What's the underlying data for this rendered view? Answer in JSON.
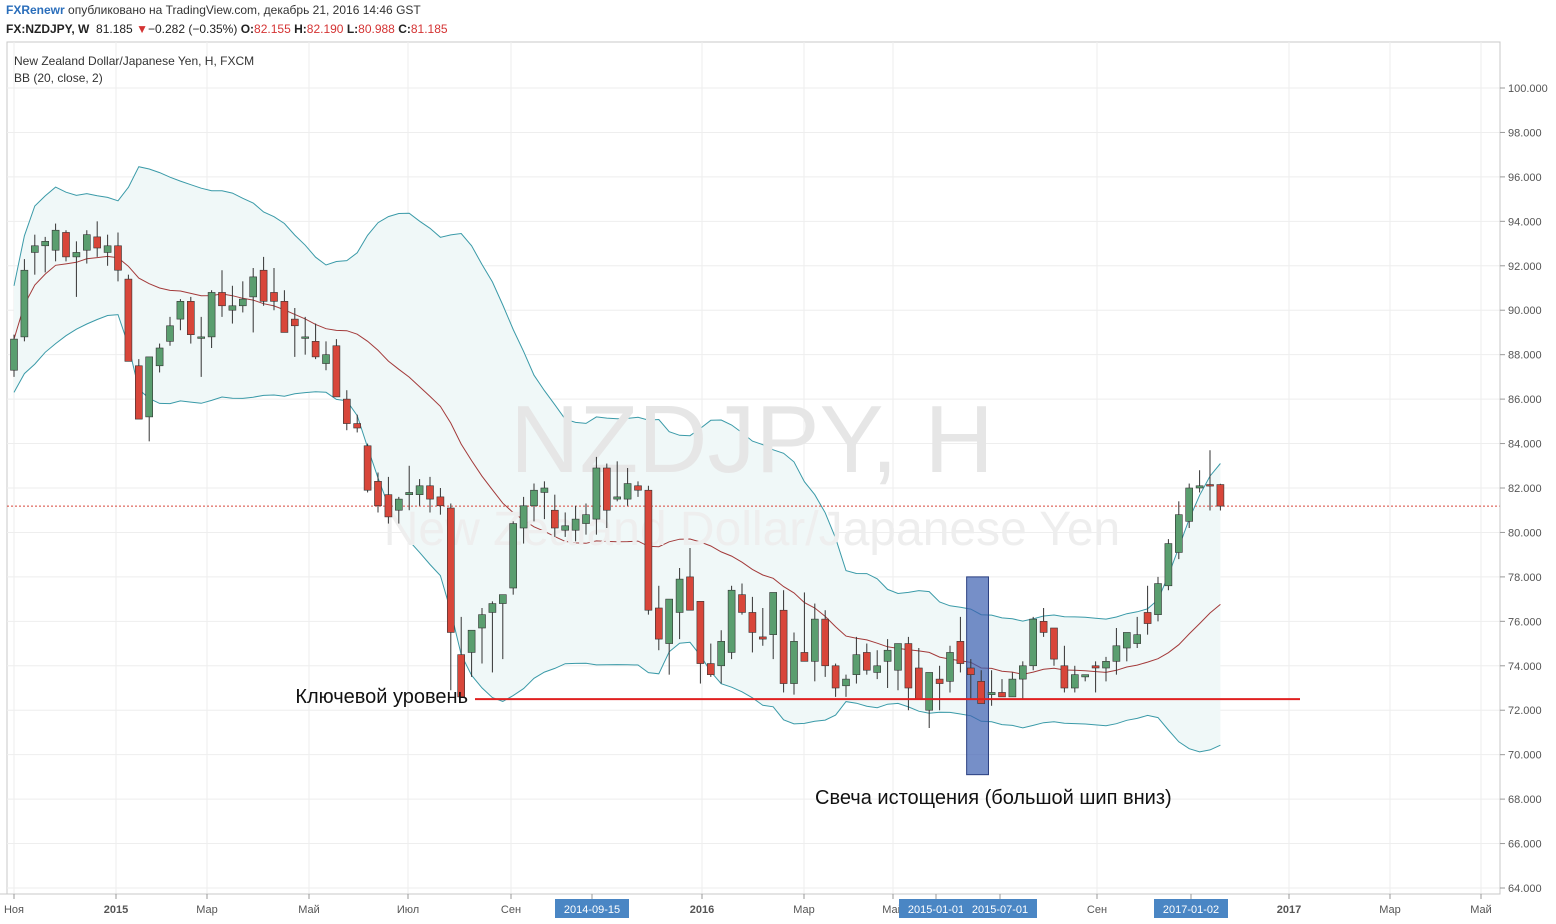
{
  "header": {
    "brand": "FXRenewr",
    "published": "опубликовано на TradingView.com, декабрь 21, 2016 14:46 GST",
    "symbol": "FX:NZDJPY, W",
    "last": "81.185",
    "down_arrow": "▼",
    "change": "−0.282 (−0.35%)",
    "o_label": "O:",
    "o_value": "82.155",
    "h_label": "H:",
    "h_value": "82.190",
    "l_label": "L:",
    "l_value": "80.988",
    "c_label": "C:",
    "c_value": "81.185"
  },
  "legend": {
    "title": "New Zealand Dollar/Japanese Yen, H, FXCM",
    "indicator": "BB (20, close, 2)"
  },
  "watermark": {
    "symbol": "NZDJPY, H",
    "name": "New Zealand Dollar/Japanese Yen"
  },
  "annotations": {
    "key_level_label": "Ключевой уровень",
    "exhaustion_label": "Свеча истощения (большой шип вниз)"
  },
  "colors": {
    "up": "#5a9e6f",
    "down": "#d8463a",
    "band": "#3a9aa8",
    "basis": "#a33a3a",
    "band_fill": "#f0f8f8",
    "key_line": "#e02020",
    "highlight": "#3c5fb0",
    "date_tag": "#4a86c4"
  },
  "chart_data": {
    "type": "candlestick",
    "y_axis": {
      "min": 64,
      "max": 100,
      "ticks": [
        "100.000",
        "98.000",
        "96.000",
        "94.000",
        "92.000",
        "90.000",
        "88.000",
        "86.000",
        "84.000",
        "82.000",
        "80.000",
        "78.000",
        "76.000",
        "74.000",
        "72.000",
        "70.000",
        "68.000",
        "66.000",
        "64.000"
      ]
    },
    "x_axis": {
      "labels": [
        "Ноя",
        "2015",
        "Мар",
        "Май",
        "Июл",
        "Сен",
        "2014-09-15",
        "2016",
        "Мар",
        "Май",
        "2015-01-01",
        "2015-07-01",
        "Сен",
        "2017-01-02",
        "2017",
        "Мар",
        "Май"
      ]
    },
    "last_price": 81.185,
    "key_level": 72.5,
    "candles": [
      {
        "o": 87.3,
        "h": 88.9,
        "l": 87.0,
        "c": 88.7
      },
      {
        "o": 88.8,
        "h": 92.3,
        "l": 88.6,
        "c": 91.8
      },
      {
        "o": 92.6,
        "h": 93.4,
        "l": 91.6,
        "c": 92.9
      },
      {
        "o": 92.9,
        "h": 93.3,
        "l": 91.7,
        "c": 93.1
      },
      {
        "o": 92.7,
        "h": 93.9,
        "l": 92.2,
        "c": 93.6
      },
      {
        "o": 93.5,
        "h": 93.6,
        "l": 92.2,
        "c": 92.4
      },
      {
        "o": 92.4,
        "h": 93.1,
        "l": 90.6,
        "c": 92.6
      },
      {
        "o": 92.7,
        "h": 93.6,
        "l": 92.1,
        "c": 93.4
      },
      {
        "o": 93.3,
        "h": 94.0,
        "l": 92.4,
        "c": 92.8
      },
      {
        "o": 92.6,
        "h": 93.4,
        "l": 92.0,
        "c": 92.9
      },
      {
        "o": 92.9,
        "h": 93.5,
        "l": 91.3,
        "c": 91.8
      },
      {
        "o": 91.4,
        "h": 91.6,
        "l": 87.8,
        "c": 87.7
      },
      {
        "o": 87.5,
        "h": 87.8,
        "l": 85.2,
        "c": 85.1
      },
      {
        "o": 85.2,
        "h": 87.7,
        "l": 84.1,
        "c": 87.9
      },
      {
        "o": 87.5,
        "h": 88.5,
        "l": 87.2,
        "c": 88.3
      },
      {
        "o": 88.6,
        "h": 89.7,
        "l": 88.4,
        "c": 89.3
      },
      {
        "o": 89.6,
        "h": 90.5,
        "l": 89.1,
        "c": 90.4
      },
      {
        "o": 90.4,
        "h": 90.6,
        "l": 88.5,
        "c": 88.9
      },
      {
        "o": 88.8,
        "h": 89.7,
        "l": 87.0,
        "c": 88.8
      },
      {
        "o": 88.8,
        "h": 90.9,
        "l": 88.3,
        "c": 90.8
      },
      {
        "o": 90.8,
        "h": 91.8,
        "l": 89.7,
        "c": 90.2
      },
      {
        "o": 90.0,
        "h": 91.1,
        "l": 89.4,
        "c": 90.2
      },
      {
        "o": 90.2,
        "h": 91.3,
        "l": 89.9,
        "c": 90.5
      },
      {
        "o": 90.6,
        "h": 91.9,
        "l": 89.0,
        "c": 91.5
      },
      {
        "o": 91.8,
        "h": 92.4,
        "l": 90.2,
        "c": 90.4
      },
      {
        "o": 90.8,
        "h": 91.9,
        "l": 90.0,
        "c": 90.4
      },
      {
        "o": 90.4,
        "h": 90.9,
        "l": 89.5,
        "c": 89.0
      },
      {
        "o": 89.6,
        "h": 90.1,
        "l": 87.9,
        "c": 89.3
      },
      {
        "o": 88.8,
        "h": 89.7,
        "l": 88.0,
        "c": 88.8
      },
      {
        "o": 88.6,
        "h": 89.4,
        "l": 87.8,
        "c": 87.9
      },
      {
        "o": 87.6,
        "h": 88.6,
        "l": 87.3,
        "c": 88.0
      },
      {
        "o": 88.4,
        "h": 88.7,
        "l": 86.1,
        "c": 86.1
      },
      {
        "o": 86.0,
        "h": 86.4,
        "l": 84.6,
        "c": 84.9
      },
      {
        "o": 84.9,
        "h": 85.3,
        "l": 84.5,
        "c": 84.7
      },
      {
        "o": 83.9,
        "h": 84.0,
        "l": 81.8,
        "c": 81.9
      },
      {
        "o": 82.3,
        "h": 82.7,
        "l": 80.9,
        "c": 81.2
      },
      {
        "o": 81.7,
        "h": 82.5,
        "l": 80.4,
        "c": 80.7
      },
      {
        "o": 81.0,
        "h": 81.6,
        "l": 80.4,
        "c": 81.5
      },
      {
        "o": 81.7,
        "h": 83.0,
        "l": 81.0,
        "c": 81.8
      },
      {
        "o": 81.7,
        "h": 82.4,
        "l": 81.2,
        "c": 82.1
      },
      {
        "o": 82.1,
        "h": 82.5,
        "l": 80.9,
        "c": 81.5
      },
      {
        "o": 81.6,
        "h": 82.0,
        "l": 80.8,
        "c": 81.2
      },
      {
        "o": 81.1,
        "h": 81.3,
        "l": 72.9,
        "c": 75.5
      },
      {
        "o": 74.5,
        "h": 76.2,
        "l": 73.8,
        "c": 72.6
      },
      {
        "o": 74.6,
        "h": 75.1,
        "l": 73.5,
        "c": 75.6
      },
      {
        "o": 75.7,
        "h": 76.6,
        "l": 74.1,
        "c": 76.3
      },
      {
        "o": 76.4,
        "h": 76.9,
        "l": 73.7,
        "c": 76.8
      },
      {
        "o": 76.8,
        "h": 77.2,
        "l": 74.3,
        "c": 77.2
      },
      {
        "o": 77.5,
        "h": 80.5,
        "l": 77.2,
        "c": 80.4
      },
      {
        "o": 80.2,
        "h": 81.6,
        "l": 79.5,
        "c": 81.2
      },
      {
        "o": 81.2,
        "h": 82.2,
        "l": 80.5,
        "c": 81.9
      },
      {
        "o": 81.8,
        "h": 82.3,
        "l": 80.6,
        "c": 82.0
      },
      {
        "o": 81.0,
        "h": 81.7,
        "l": 79.8,
        "c": 80.2
      },
      {
        "o": 80.1,
        "h": 80.9,
        "l": 79.8,
        "c": 80.3
      },
      {
        "o": 80.1,
        "h": 81.2,
        "l": 79.6,
        "c": 80.6
      },
      {
        "o": 80.4,
        "h": 81.3,
        "l": 79.9,
        "c": 80.8
      },
      {
        "o": 80.6,
        "h": 83.4,
        "l": 79.9,
        "c": 82.9
      },
      {
        "o": 82.9,
        "h": 83.1,
        "l": 80.2,
        "c": 81.0
      },
      {
        "o": 81.5,
        "h": 83.2,
        "l": 81.4,
        "c": 81.6
      },
      {
        "o": 81.5,
        "h": 82.9,
        "l": 81.2,
        "c": 82.2
      },
      {
        "o": 82.1,
        "h": 82.3,
        "l": 81.6,
        "c": 81.9
      },
      {
        "o": 81.9,
        "h": 82.1,
        "l": 76.3,
        "c": 76.5
      },
      {
        "o": 76.6,
        "h": 77.6,
        "l": 74.7,
        "c": 75.2
      },
      {
        "o": 75.0,
        "h": 75.9,
        "l": 73.6,
        "c": 77.0
      },
      {
        "o": 76.4,
        "h": 78.4,
        "l": 75.2,
        "c": 77.9
      },
      {
        "o": 78.0,
        "h": 79.3,
        "l": 76.5,
        "c": 76.5
      },
      {
        "o": 76.9,
        "h": 76.9,
        "l": 73.2,
        "c": 74.1
      },
      {
        "o": 74.1,
        "h": 75.0,
        "l": 73.5,
        "c": 73.6
      },
      {
        "o": 74.0,
        "h": 75.6,
        "l": 73.2,
        "c": 75.1
      },
      {
        "o": 74.6,
        "h": 77.6,
        "l": 74.3,
        "c": 77.4
      },
      {
        "o": 77.2,
        "h": 77.7,
        "l": 76.3,
        "c": 76.4
      },
      {
        "o": 76.4,
        "h": 77.1,
        "l": 74.6,
        "c": 75.5
      },
      {
        "o": 75.3,
        "h": 76.6,
        "l": 74.9,
        "c": 75.2
      },
      {
        "o": 75.4,
        "h": 77.2,
        "l": 74.3,
        "c": 77.3
      },
      {
        "o": 76.5,
        "h": 77.4,
        "l": 72.8,
        "c": 73.2
      },
      {
        "o": 73.2,
        "h": 75.5,
        "l": 72.7,
        "c": 75.1
      },
      {
        "o": 74.6,
        "h": 77.3,
        "l": 74.2,
        "c": 74.2
      },
      {
        "o": 74.2,
        "h": 76.8,
        "l": 73.3,
        "c": 76.1
      },
      {
        "o": 76.1,
        "h": 76.5,
        "l": 73.5,
        "c": 74.0
      },
      {
        "o": 74.0,
        "h": 74.1,
        "l": 72.6,
        "c": 73.0
      },
      {
        "o": 73.1,
        "h": 73.6,
        "l": 72.6,
        "c": 73.4
      },
      {
        "o": 73.6,
        "h": 75.3,
        "l": 73.2,
        "c": 74.5
      },
      {
        "o": 74.6,
        "h": 75.0,
        "l": 73.6,
        "c": 73.8
      },
      {
        "o": 73.7,
        "h": 74.7,
        "l": 73.4,
        "c": 74.0
      },
      {
        "o": 74.2,
        "h": 75.2,
        "l": 73.0,
        "c": 74.7
      },
      {
        "o": 73.8,
        "h": 75.0,
        "l": 72.9,
        "c": 75.0
      },
      {
        "o": 75.0,
        "h": 75.3,
        "l": 72.0,
        "c": 73.0
      },
      {
        "o": 73.9,
        "h": 74.8,
        "l": 72.6,
        "c": 72.5
      },
      {
        "o": 72.0,
        "h": 73.7,
        "l": 71.2,
        "c": 73.7
      },
      {
        "o": 73.4,
        "h": 74.0,
        "l": 72.0,
        "c": 73.2
      },
      {
        "o": 73.3,
        "h": 74.9,
        "l": 72.8,
        "c": 74.6
      },
      {
        "o": 75.1,
        "h": 76.2,
        "l": 73.7,
        "c": 74.1
      },
      {
        "o": 73.9,
        "h": 74.3,
        "l": 72.5,
        "c": 73.6
      },
      {
        "o": 73.3,
        "h": 73.8,
        "l": 72.3,
        "c": 72.3
      },
      {
        "o": 72.7,
        "h": 73.8,
        "l": 72.2,
        "c": 72.8
      },
      {
        "o": 72.8,
        "h": 73.4,
        "l": 72.6,
        "c": 72.6
      },
      {
        "o": 72.6,
        "h": 73.7,
        "l": 72.6,
        "c": 73.4
      },
      {
        "o": 73.4,
        "h": 74.2,
        "l": 72.5,
        "c": 74.0
      },
      {
        "o": 74.0,
        "h": 76.2,
        "l": 73.8,
        "c": 76.1
      },
      {
        "o": 76.0,
        "h": 76.6,
        "l": 75.3,
        "c": 75.5
      },
      {
        "o": 75.7,
        "h": 75.7,
        "l": 74.0,
        "c": 74.3
      },
      {
        "o": 74.0,
        "h": 74.9,
        "l": 72.8,
        "c": 73.0
      },
      {
        "o": 73.0,
        "h": 74.0,
        "l": 72.8,
        "c": 73.6
      },
      {
        "o": 73.5,
        "h": 73.6,
        "l": 73.3,
        "c": 73.6
      },
      {
        "o": 74.0,
        "h": 74.2,
        "l": 72.8,
        "c": 73.9
      },
      {
        "o": 73.9,
        "h": 74.4,
        "l": 73.3,
        "c": 74.2
      },
      {
        "o": 74.2,
        "h": 75.7,
        "l": 73.6,
        "c": 74.9
      },
      {
        "o": 74.8,
        "h": 75.3,
        "l": 74.2,
        "c": 75.5
      },
      {
        "o": 75.0,
        "h": 76.2,
        "l": 74.8,
        "c": 75.4
      },
      {
        "o": 76.4,
        "h": 77.6,
        "l": 75.4,
        "c": 75.9
      },
      {
        "o": 76.3,
        "h": 78.0,
        "l": 76.0,
        "c": 77.7
      },
      {
        "o": 77.6,
        "h": 79.7,
        "l": 77.4,
        "c": 79.5
      },
      {
        "o": 79.1,
        "h": 81.4,
        "l": 78.8,
        "c": 80.8
      },
      {
        "o": 80.5,
        "h": 82.2,
        "l": 80.2,
        "c": 82.0
      },
      {
        "o": 82.0,
        "h": 82.8,
        "l": 81.8,
        "c": 82.1
      },
      {
        "o": 82.155,
        "h": 83.7,
        "l": 80.988,
        "c": 82.1
      },
      {
        "o": 82.155,
        "h": 82.19,
        "l": 80.988,
        "c": 81.185
      }
    ]
  }
}
